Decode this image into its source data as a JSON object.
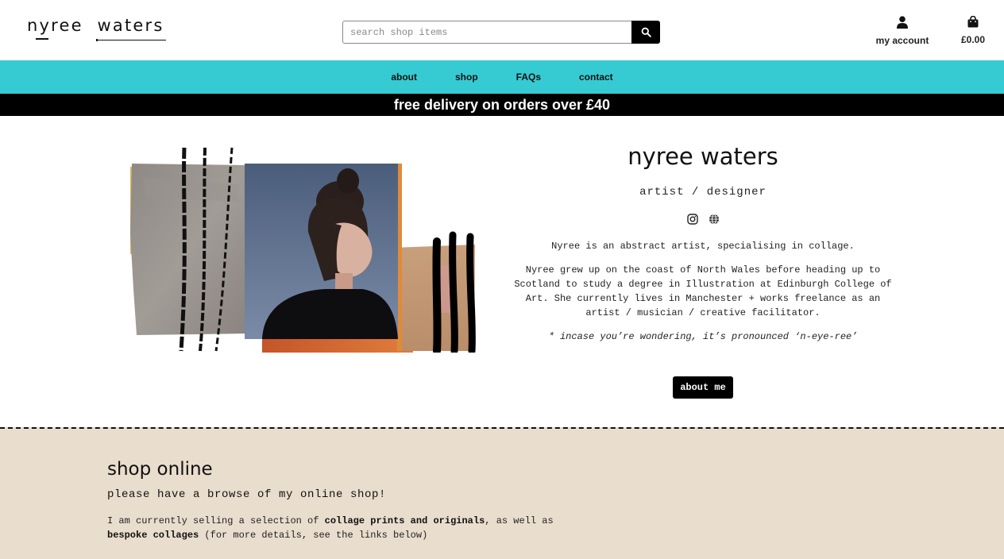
{
  "header": {
    "logo_text": "nyree  waters",
    "search_placeholder": "search shop items",
    "account_label": "my account",
    "cart_total": "£0.00"
  },
  "nav": {
    "items": [
      "about",
      "shop",
      "FAQs",
      "contact"
    ]
  },
  "banner": {
    "text": "free delivery on orders over £40"
  },
  "hero": {
    "name": "nyree waters",
    "role": "artist / designer",
    "social_icons": [
      "instagram-icon",
      "globe-icon"
    ],
    "intro": "Nyree is an abstract artist, specialising in collage.",
    "bio": "Nyree grew up on the coast of North Wales before heading up to Scotland to study a degree in Illustration at Edinburgh College of Art. She currently lives in Manchester + works freelance as an artist / musician / creative facilitator.",
    "pronunciation": "* incase you’re wondering, it’s pronounced ‘n-eye-ree’",
    "button_label": "about me"
  },
  "shop": {
    "title": "shop online",
    "subtitle": "please have a browse of my online shop!",
    "desc_part1": "I am currently selling a selection of ",
    "desc_bold1": "collage prints and originals",
    "desc_part2": ", as well as ",
    "desc_bold2": "bespoke collages",
    "desc_part3": " (for more details, see the links below)"
  },
  "colors": {
    "nav_bg": "#36cbd2",
    "banner_bg": "#000000",
    "shop_bg": "#e9ddcd",
    "accent_orange": "#d9662e"
  }
}
